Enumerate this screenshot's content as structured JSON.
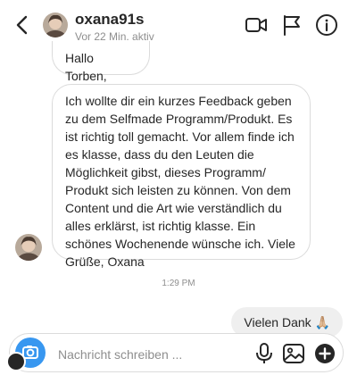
{
  "header": {
    "username": "oxana91s",
    "status": "Vor 22 Min. aktiv",
    "icons": [
      "back-icon",
      "video-camera-icon",
      "flag-icon",
      "info-icon"
    ]
  },
  "messages": [
    {
      "sender": "incoming",
      "text": "Hallo Torben,"
    },
    {
      "sender": "incoming",
      "text": "Ich wollte dir ein kurzes Feedback geben\nzu dem Selfmade Programm/Produkt. Es\nist richtig toll gemacht. Vor allem finde ich\nes klasse, dass du den Leuten die\nMöglichkeit gibst, dieses Programm/\nProdukt sich leisten zu können. Von dem\nContent und die Art wie verständlich du\nalles erklärst, ist richtig klasse. Ein\nschönes Wochenende wünsche ich. Viele\nGrüße, Oxana"
    }
  ],
  "timestamp": "1:29 PM",
  "reply": {
    "text": "Vielen Dank",
    "emoji": "🙏🏼"
  },
  "composer": {
    "placeholder": "Nachricht schreiben ...",
    "icons": [
      "camera-icon",
      "microphone-icon",
      "gallery-icon",
      "add-icon"
    ]
  },
  "colors": {
    "accent": "#3897f0",
    "bubble_border": "#dbdbdb",
    "outgoing_bg": "#efefef",
    "muted": "#8e8e8e"
  }
}
